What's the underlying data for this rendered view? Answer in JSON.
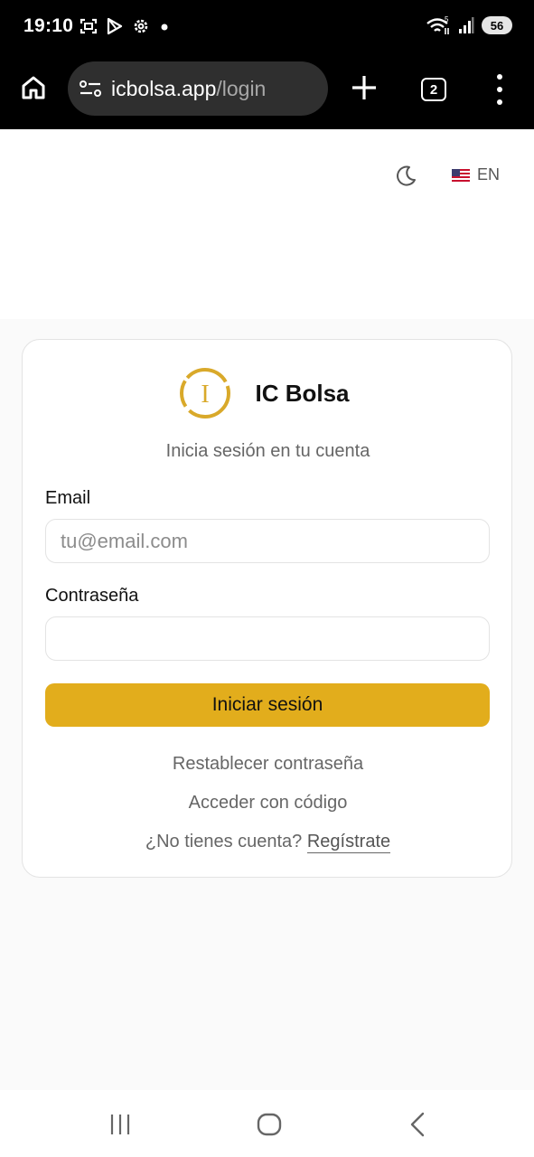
{
  "status_bar": {
    "time": "19:10",
    "battery": "56",
    "left_icons": [
      "screenshot-icon",
      "play-store-icon",
      "settings-icon",
      "notification-dot-icon"
    ],
    "right_icons": [
      "wifi-icon",
      "signal-icon",
      "battery-icon"
    ]
  },
  "browser": {
    "url_host": "icbolsa.app",
    "url_path": "/login",
    "tab_count": "2"
  },
  "header": {
    "language": "EN"
  },
  "login": {
    "brand_name": "IC Bolsa",
    "logo_letter": "I",
    "subtitle": "Inicia sesión en tu cuenta",
    "email_label": "Email",
    "email_placeholder": "tu@email.com",
    "email_value": "",
    "password_label": "Contraseña",
    "password_value": "",
    "submit_label": "Iniciar sesión",
    "reset_password": "Restablecer contraseña",
    "code_access": "Acceder con código",
    "no_account": "¿No tienes cuenta?",
    "register": "Regístrate"
  },
  "colors": {
    "accent": "#e2ad1c",
    "logo_gold": "#d9a92a"
  }
}
